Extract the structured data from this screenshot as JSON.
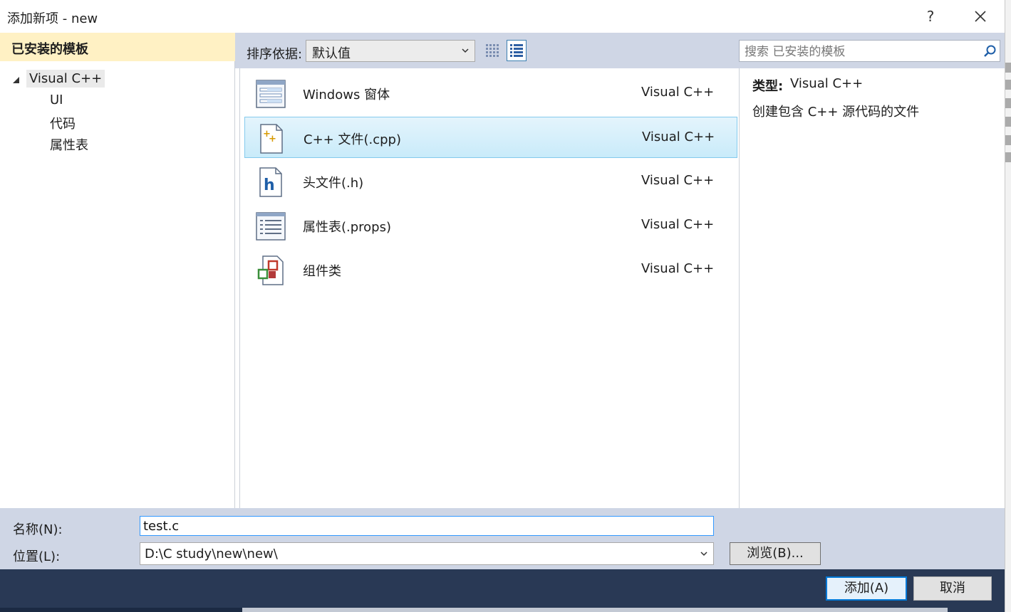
{
  "window": {
    "title": "添加新项 - new",
    "help_label": "?"
  },
  "left": {
    "header": "已安装的模板",
    "root": "Visual C++",
    "children": [
      "UI",
      "代码",
      "属性表"
    ]
  },
  "toolbar": {
    "sort_label": "排序依据:",
    "sort_value": "默认值",
    "search_placeholder": "搜索 已安装的模板"
  },
  "items": [
    {
      "name": "Windows 窗体",
      "type": "Visual C++",
      "icon": "windows-form-icon",
      "selected": false
    },
    {
      "name": "C++ 文件(.cpp)",
      "type": "Visual C++",
      "icon": "cpp-file-icon",
      "selected": true
    },
    {
      "name": "头文件(.h)",
      "type": "Visual C++",
      "icon": "header-file-icon",
      "selected": false
    },
    {
      "name": "属性表(.props)",
      "type": "Visual C++",
      "icon": "property-sheet-icon",
      "selected": false
    },
    {
      "name": "组件类",
      "type": "Visual C++",
      "icon": "component-class-icon",
      "selected": false
    }
  ],
  "info": {
    "type_label": "类型:",
    "type_value": "Visual C++",
    "description": "创建包含 C++ 源代码的文件"
  },
  "bottom": {
    "name_label": "名称(N):",
    "name_value": "test.c",
    "location_label": "位置(L):",
    "location_value": "D:\\C study\\new\\new\\",
    "browse_label": "浏览(B)..."
  },
  "buttons": {
    "add": "添加(A)",
    "cancel": "取消"
  },
  "colors": {
    "accent": "#0078d7",
    "toolbar_bg": "#cfd6e5",
    "header_bg": "#fff1c4",
    "selection_border": "#84caed"
  }
}
